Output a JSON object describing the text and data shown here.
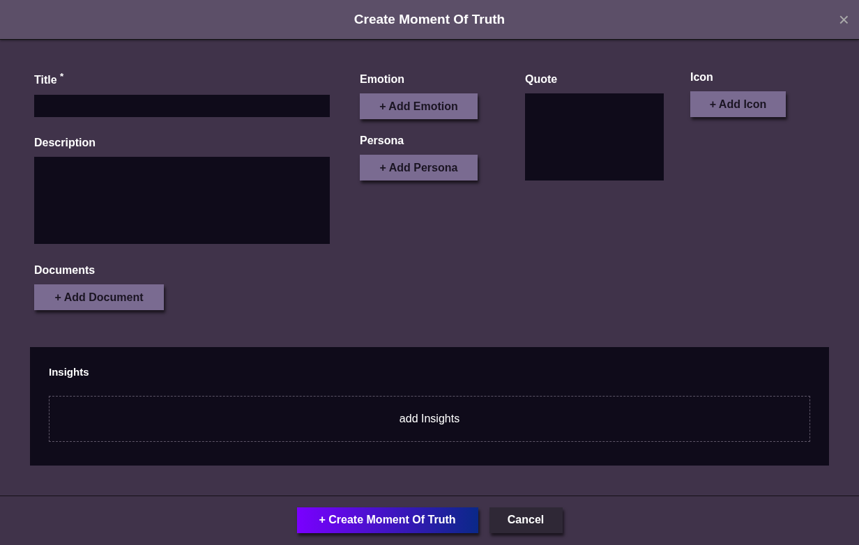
{
  "dialog": {
    "title": "Create Moment Of Truth",
    "close": "×"
  },
  "fields": {
    "title": {
      "label": "Title $^{*}$"
    },
    "description": {
      "label": "Description"
    },
    "documents": {
      "label": "Documents",
      "button": "+ Add Document"
    },
    "emotion": {
      "label": "Emotion",
      "button": "+ Add Emotion"
    },
    "persona": {
      "label": "Persona",
      "button": "+ Add Persona"
    },
    "quote": {
      "label": "Quote"
    },
    "icon": {
      "label": "Icon",
      "button": "+ Add Icon"
    }
  },
  "insights": {
    "label": "Insights",
    "placeholder": "add Insights"
  },
  "footer": {
    "buttons": [
      {
        "kind": "primary",
        "label": "+ Create Moment Of Truth"
      },
      {
        "kind": "secondary",
        "label": "Cancel"
      }
    ]
  }
}
